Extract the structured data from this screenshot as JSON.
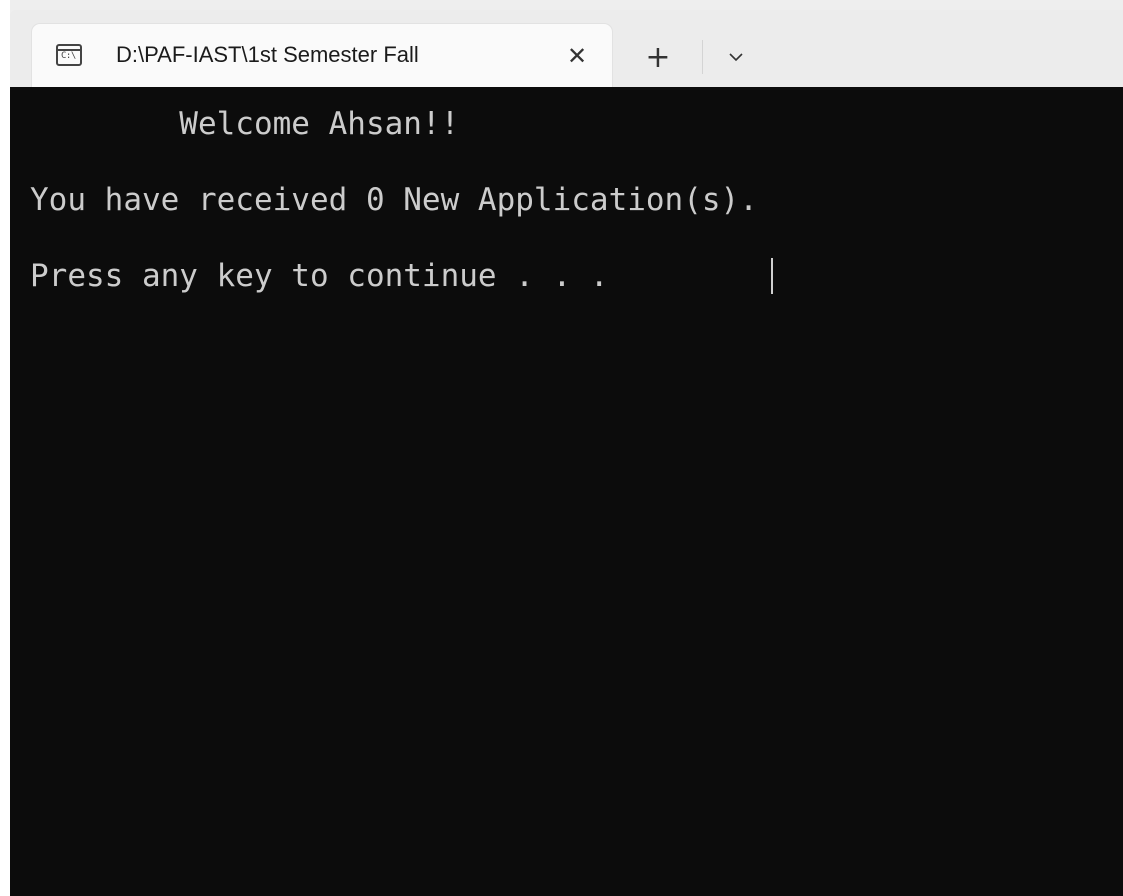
{
  "tab": {
    "icon": "cmd-icon",
    "icon_text": "C:\\",
    "title": "D:\\PAF-IAST\\1st Semester Fall",
    "close_glyph": "✕"
  },
  "toolbar": {
    "new_tab_glyph": "+",
    "dropdown_icon": "chevron-down-icon"
  },
  "console": {
    "lines": [
      "        Welcome Ahsan!!",
      "You have received 0 New Application(s).",
      "Press any key to continue . . ."
    ],
    "background": "#0c0c0c",
    "foreground": "#cccccc"
  }
}
